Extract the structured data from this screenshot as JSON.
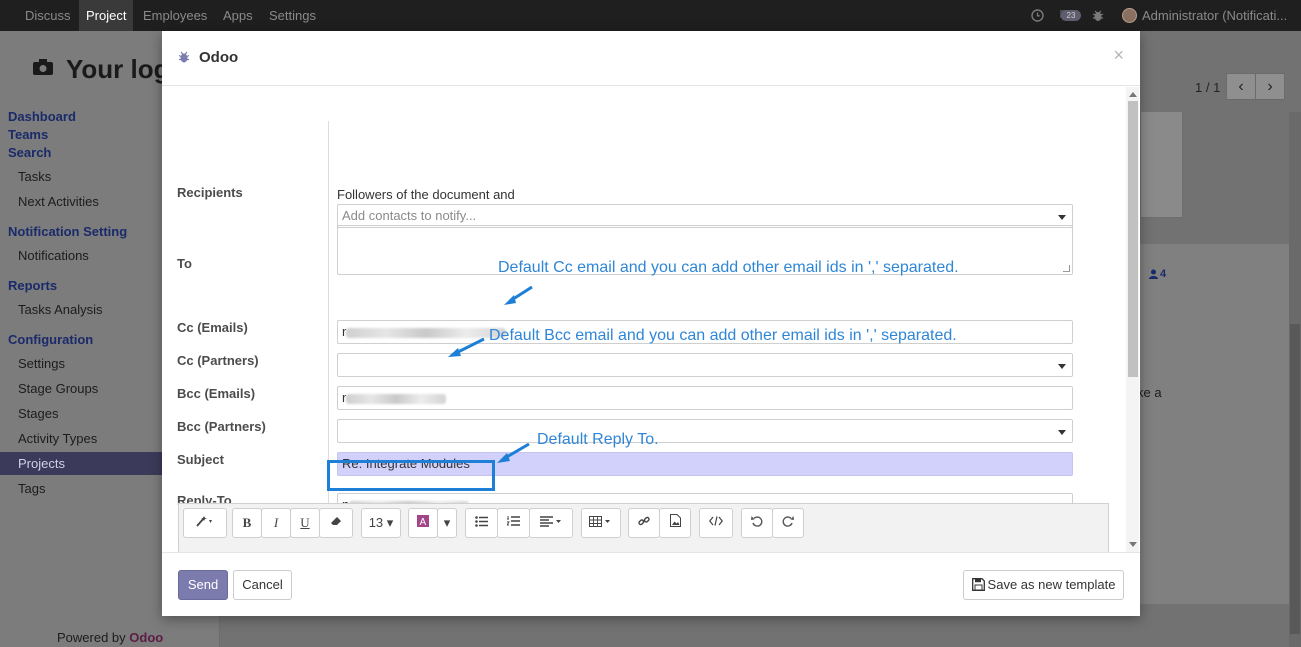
{
  "navbar": {
    "menu": [
      "Discuss",
      "Project",
      "Employees",
      "Apps",
      "Settings"
    ],
    "active": "Project",
    "message_count": "23",
    "user": "Administrator (Notificati..."
  },
  "background": {
    "page_title": "Your log",
    "sidebar": {
      "sections": [
        {
          "title": "Dashboard"
        },
        {
          "title": "Teams"
        },
        {
          "title": "Search",
          "items": [
            "Tasks",
            "Next Activities"
          ]
        },
        {
          "title": "Notification Setting",
          "items": [
            "Notifications"
          ]
        },
        {
          "title": "Reports",
          "items": [
            "Tasks Analysis"
          ]
        },
        {
          "title": "Configuration",
          "items": [
            "Settings",
            "Stage Groups",
            "Stages",
            "Activity Types",
            "Projects",
            "Tags"
          ]
        }
      ],
      "active_item": "Projects"
    },
    "pager": "1 / 1",
    "followers_count": "4",
    "snippet": "ke a",
    "powered_by": "Powered by",
    "powered_brand": "Odoo"
  },
  "modal": {
    "title": "Odoo",
    "close": "×",
    "labels": {
      "recipients": "Recipients",
      "to": "To",
      "cc_emails": "Cc (Emails)",
      "cc_partners": "Cc (Partners)",
      "bcc_emails": "Bcc (Emails)",
      "bcc_partners": "Bcc (Partners)",
      "subject": "Subject",
      "reply_to": "Reply-To"
    },
    "followers_text": "Followers of the document and",
    "recipients_placeholder": "Add contacts to notify...",
    "cc_emails_prefix": "r",
    "bcc_emails_prefix": "r",
    "reply_to_prefix": "n",
    "subject_value": "Re: Integrate Modules",
    "font_size": "13",
    "send_label": "Send",
    "cancel_label": "Cancel",
    "save_template_label": "Save as new template"
  },
  "annotations": {
    "cc": "Default Cc email and you can add other email ids in ',' separated.",
    "bcc": "Default Bcc email and you can add other email ids in ',' separated.",
    "reply_to": "Default Reply To."
  },
  "colors": {
    "navbar": "#1f1f1f",
    "primary": "#7c7bad",
    "subject_bg": "#d2d1fb",
    "annotation": "#2f86d6",
    "sidebar_section": "#1a2a6a"
  }
}
